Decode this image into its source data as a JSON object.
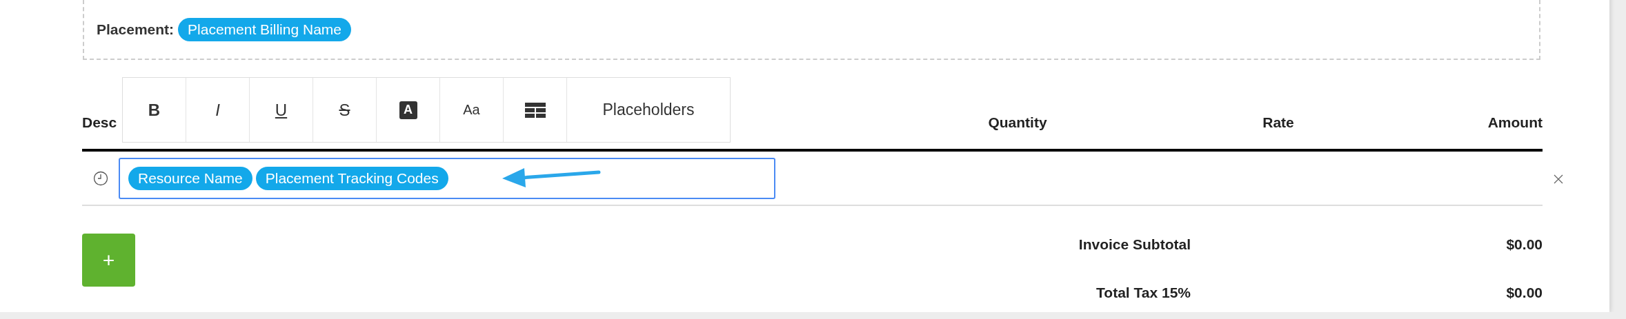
{
  "placement": {
    "label": "Placement:",
    "tag": "Placement Billing Name"
  },
  "table": {
    "columns": [
      "Desc",
      "Quantity",
      "Rate",
      "Amount"
    ]
  },
  "toolbar": [
    {
      "kind": "bold",
      "label": "B"
    },
    {
      "kind": "italic",
      "label": "I"
    },
    {
      "kind": "underline",
      "label": "U"
    },
    {
      "kind": "strike",
      "label": "S"
    },
    {
      "kind": "color",
      "label": "A"
    },
    {
      "kind": "size",
      "label": "Aa"
    },
    {
      "kind": "table"
    },
    {
      "kind": "menu",
      "label": "Placeholders"
    }
  ],
  "row": {
    "tags": [
      "Resource Name",
      "Placement Tracking Codes"
    ]
  },
  "add_button": "+",
  "totals": [
    {
      "label": "Invoice Subtotal",
      "value": "$0.00"
    },
    {
      "label": "Total Tax 15%",
      "value": "$0.00"
    }
  ]
}
